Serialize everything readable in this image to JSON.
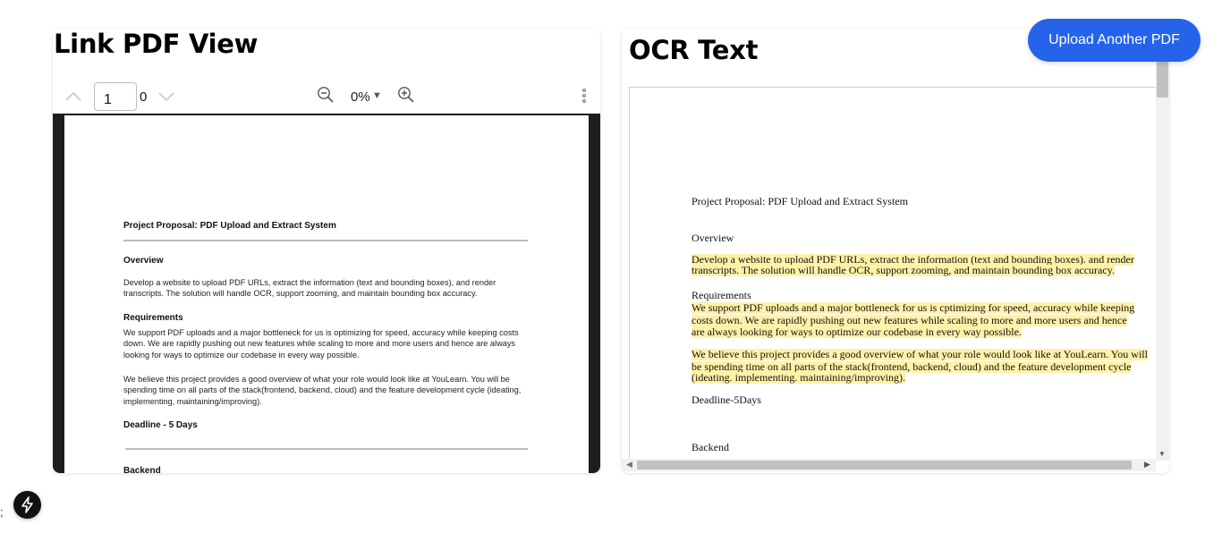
{
  "left_panel": {
    "title": "Link PDF View",
    "toolbar": {
      "page_input_value": "1",
      "total_pages": "0",
      "zoom_value": "0%",
      "zoom_caret": "▼"
    },
    "pdf_page": {
      "title": "Project Proposal: PDF Upload and Extract System",
      "overview_heading": "Overview",
      "overview_text": "Develop a website to upload PDF URLs, extract the information (text and bounding boxes), and render transcripts. The solution will handle OCR, support zooming, and maintain bounding box accuracy.",
      "requirements_heading": "Requirements",
      "requirements_text": "We support PDF uploads and a major bottleneck for us is optimizing for speed, accuracy while keeping costs down. We are rapidly pushing out new features while scaling to more and more users and hence are always looking for ways to optimize our codebase in every way possible.",
      "believe_text": "We believe this project provides a good overview of what your role would look like at YouLearn. You will be spending time on all parts of the stack(frontend, backend, cloud) and the feature development cycle (ideating, implementing, maintaining/improving).",
      "deadline_heading": "Deadline - 5 Days",
      "backend_heading": "Backend"
    }
  },
  "right_panel": {
    "title": "OCR Text",
    "ocr": {
      "title": "Project Proposal: PDF Upload and Extract System",
      "overview": "Overview",
      "overview_l1": "Develop a website to upload PDF URLs, extract the information (text and bounding boxes). and render",
      "overview_l2": "transcripts. The solution will handle OCR, support zooming, and maintain bounding box accuracy.",
      "requirements": "Requirements",
      "req_l1": "We support PDF uploads and a major bottleneck for us is cptimizing for speed, accuracy while keeping",
      "req_l2": "costs down. We are rapidly pushing out new features while scaling to more and more users and hence",
      "req_l3": "are always looking for ways to optimize our codebase in every way possible.",
      "believe_l1": "We believe this project provides a good overview of what your role would look like at YouLearn. You will",
      "believe_l2": "be spending time on all parts of the stack(frontend, backend, cloud) and the feature development cycle",
      "believe_l3": "(ideating. implementing. maintaining/improving).",
      "deadline": "Deadline-5Days",
      "backend": "Backend"
    }
  },
  "upload_button": {
    "label": "Upload Another PDF"
  },
  "badge": {
    "semicolon": ";"
  },
  "colors": {
    "accent": "#2563eb",
    "highlight": "#fff2a8",
    "viewer_bg": "#1e1e1e"
  },
  "icons": [
    "chevron-up-icon",
    "chevron-down-icon",
    "zoom-out-icon",
    "zoom-in-icon",
    "more-vertical-icon",
    "next-logo-icon"
  ]
}
